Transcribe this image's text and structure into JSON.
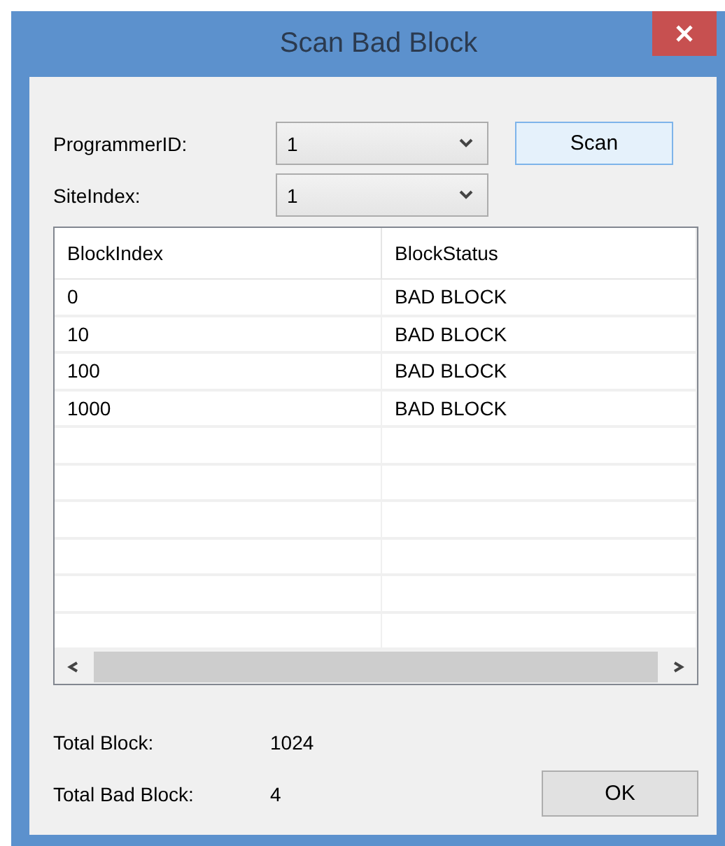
{
  "window": {
    "title": "Scan Bad Block"
  },
  "fields": [
    {
      "label": "ProgrammerID:",
      "value": "1"
    },
    {
      "label": "SiteIndex:",
      "value": "1"
    }
  ],
  "scan_button": "Scan",
  "table": {
    "columns": [
      "BlockIndex",
      "BlockStatus"
    ],
    "rows": [
      [
        "0",
        "BAD BLOCK"
      ],
      [
        "10",
        "BAD BLOCK"
      ],
      [
        "100",
        "BAD BLOCK"
      ],
      [
        "1000",
        "BAD BLOCK"
      ]
    ]
  },
  "totals": [
    {
      "label": "Total Block:",
      "value": "1024"
    },
    {
      "label": "Total Bad Block:",
      "value": "4"
    }
  ],
  "ok_button": "OK"
}
